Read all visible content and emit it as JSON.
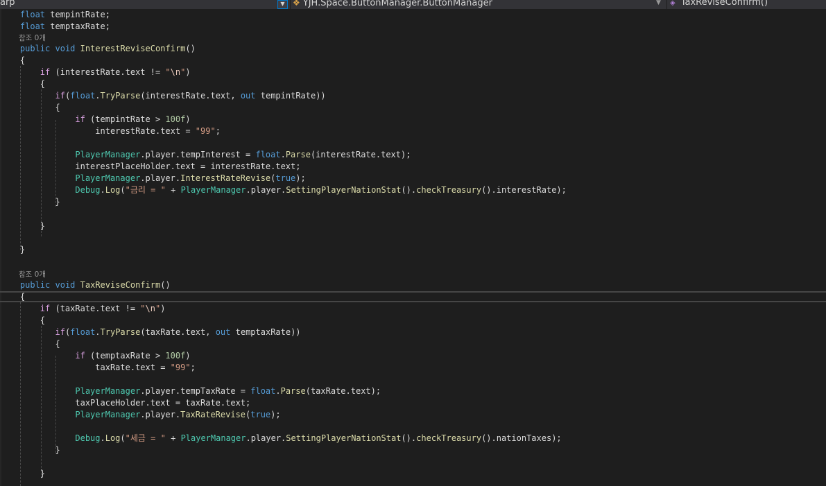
{
  "navbar": {
    "project": "arp",
    "class_path": "YJH.Space.ButtonManager.ButtonManager",
    "member": "TaxReviseConfirm()"
  },
  "code": {
    "lens_ref_label": "참조 0개",
    "field1_type": "float",
    "field1_name": "tempintRate;",
    "field2_type": "float",
    "field2_name": "temptaxRate;",
    "method1": {
      "modifier": "public",
      "ret": "void",
      "name": "InterestReviseConfirm",
      "params": "()"
    },
    "method2": {
      "modifier": "public",
      "ret": "void",
      "name": "TaxReviseConfirm",
      "params": "()"
    },
    "kw_if": "if",
    "kw_float": "float",
    "kw_out": "out",
    "kw_true": "true",
    "m1": {
      "if_cond_pre": " (interestRate.text != ",
      "if_cond_str_a": "\"",
      "if_cond_esc": "\\n",
      "if_cond_str_b": "\"",
      "if_cond_post": ")",
      "tryparse_open": "(",
      "tryparse_fn": "TryParse",
      "tryparse_args": "(interestRate.text, ",
      "tryparse_var": " tempintRate))",
      "cmp_pre": " (tempintRate > ",
      "cmp_num": "100f",
      "cmp_post": ")",
      "assign_lhs": "interestRate.text = ",
      "assign_str": "\"99\"",
      "assign_end": ";",
      "pm": "PlayerManager",
      "line_temp_mid": ".player.tempInterest = ",
      "parse_fn": "Parse",
      "parse_args": "(interestRate.text);",
      "placeholder_line": "interestPlaceHolder.text = interestRate.text;",
      "revise_mid": ".player.",
      "revise_fn": "InterestRateRevise",
      "revise_end": ");",
      "debug_type": "Debug",
      "debug_fn": "Log",
      "debug_str": "\"금리 = \"",
      "debug_plus": " + ",
      "debug_chain1": ".player.",
      "setting_fn": "SettingPlayerNationStat",
      "check_fn": "checkTreasury",
      "debug_tail": "().interestRate);"
    },
    "m2": {
      "if_cond_pre": " (taxRate.text != ",
      "if_cond_str_a": "\"",
      "if_cond_esc": "\\n",
      "if_cond_str_b": "\"",
      "if_cond_post": ")",
      "tryparse_open": "(",
      "tryparse_fn": "TryParse",
      "tryparse_args": "(taxRate.text, ",
      "tryparse_var": " temptaxRate))",
      "cmp_pre": " (temptaxRate > ",
      "cmp_num": "100f",
      "cmp_post": ")",
      "assign_lhs": "taxRate.text = ",
      "assign_str": "\"99\"",
      "assign_end": ";",
      "pm": "PlayerManager",
      "line_temp_mid": ".player.tempTaxRate = ",
      "parse_fn": "Parse",
      "parse_args": "(taxRate.text);",
      "placeholder_line": "taxPlaceHolder.text = taxRate.text;",
      "revise_mid": ".player.",
      "revise_fn": "TaxRateRevise",
      "revise_end": ");",
      "debug_type": "Debug",
      "debug_fn": "Log",
      "debug_str": "\"세금 = \"",
      "debug_plus": " + ",
      "debug_chain1": ".player.",
      "setting_fn": "SettingPlayerNationStat",
      "check_fn": "checkTreasury",
      "debug_tail": "().nationTaxes);"
    },
    "brace_open": "{",
    "brace_close": "}",
    "dot": ".",
    "call_mid": "().",
    "paren_open": "(",
    "comma_sp": ", "
  }
}
